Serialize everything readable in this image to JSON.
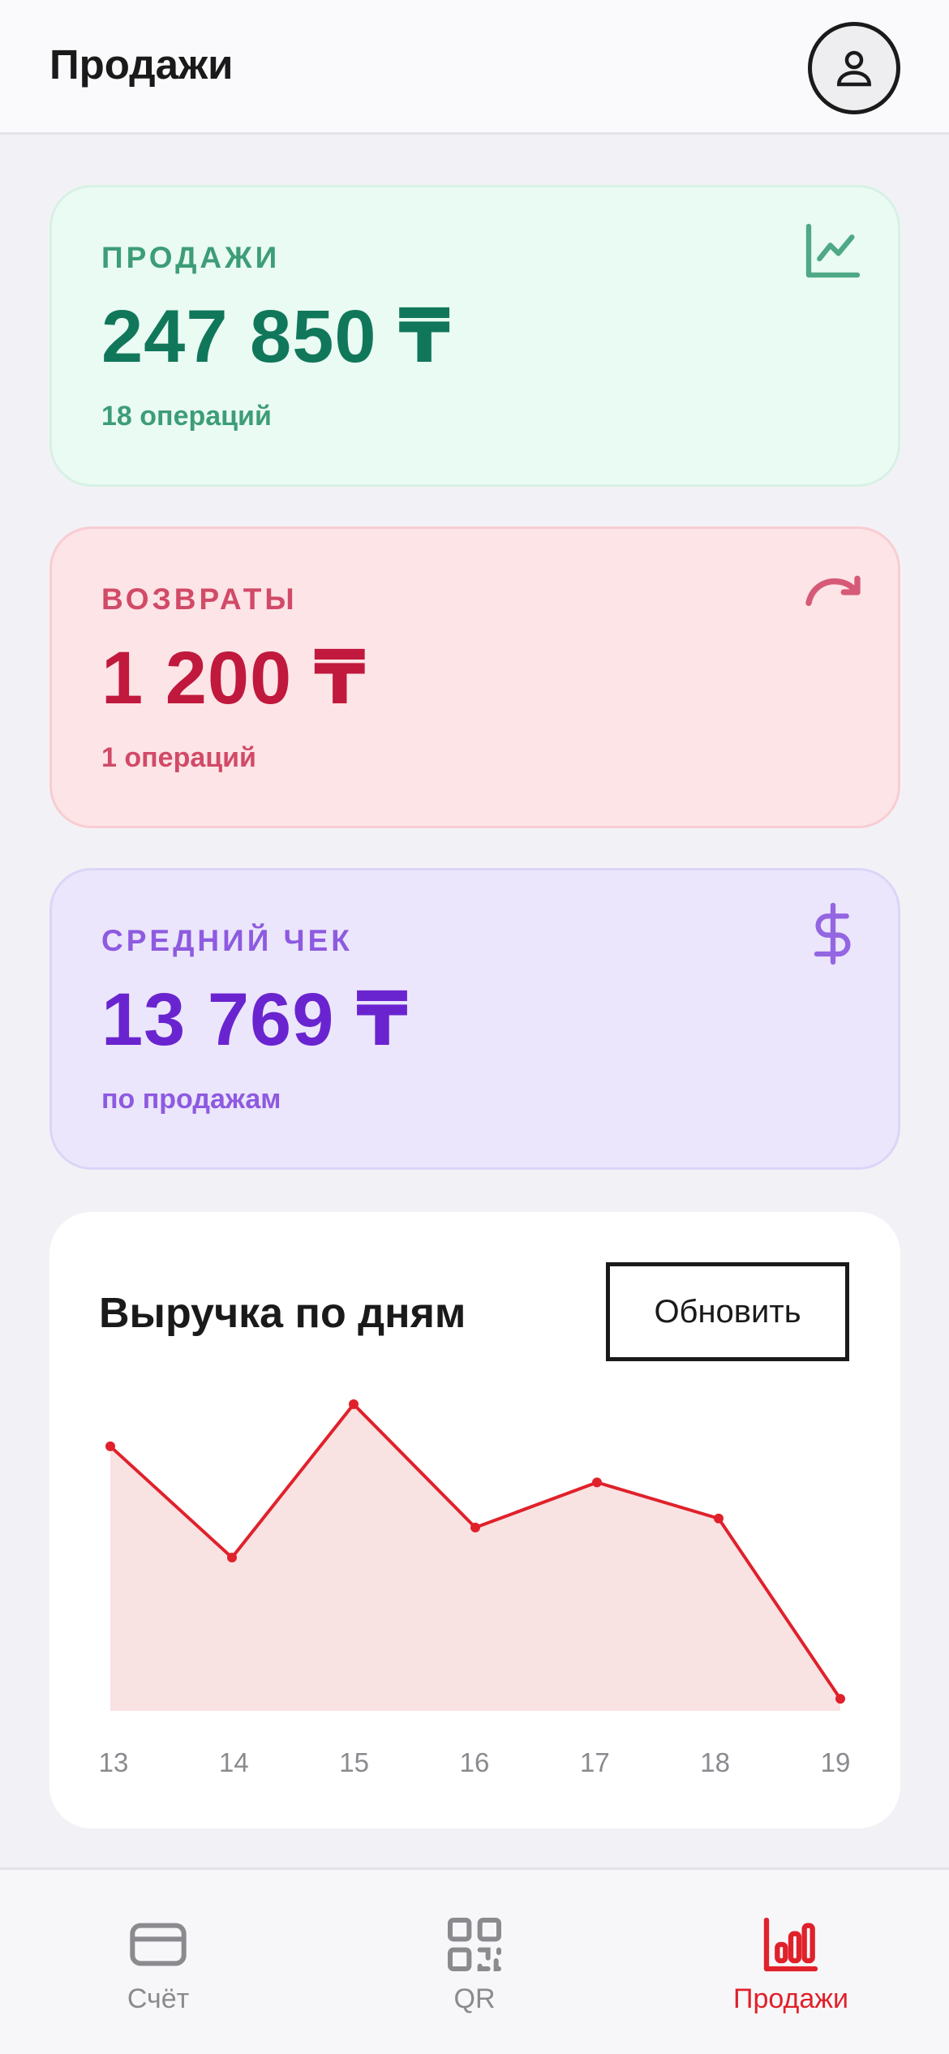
{
  "header": {
    "title": "Продажи",
    "avatar_icon": "user-icon"
  },
  "cards": {
    "sales": {
      "label": "ПРОДАЖИ",
      "value": "247 850 ₸",
      "sub": "18 операций",
      "icon": "line-chart-icon"
    },
    "returns": {
      "label": "ВОЗВРАТЫ",
      "value": "1 200 ₸",
      "sub": "1 операций",
      "icon": "redo-arrow-icon"
    },
    "average": {
      "label": "СРЕДНИЙ ЧЕК",
      "value": "13 769 ₸",
      "sub": "по продажам",
      "icon": "dollar-icon"
    }
  },
  "revenue_chart": {
    "title": "Выручка по дням",
    "refresh_label": "Обновить"
  },
  "chart_data": {
    "type": "area",
    "title": "Выручка по дням",
    "x": [
      "13",
      "14",
      "15",
      "16",
      "17",
      "18",
      "19"
    ],
    "series": [
      {
        "values": [
          44000,
          25500,
          51000,
          30500,
          38000,
          32000,
          2000
        ]
      }
    ],
    "ylim": [
      0,
      56000
    ],
    "grid": false,
    "colors": {
      "line": "#e0212b",
      "fill": "#f9e2e2"
    }
  },
  "tabbar": {
    "items": [
      {
        "label": "Счёт",
        "icon": "card-icon",
        "active": false
      },
      {
        "label": "QR",
        "icon": "qr-code-icon",
        "active": false
      },
      {
        "label": "Продажи",
        "icon": "bar-chart-icon",
        "active": true
      }
    ]
  },
  "colors": {
    "accent": "#e0212b",
    "sales_green": "#11775a",
    "returns_red": "#c0193d",
    "average_purple": "#6a24cf"
  }
}
